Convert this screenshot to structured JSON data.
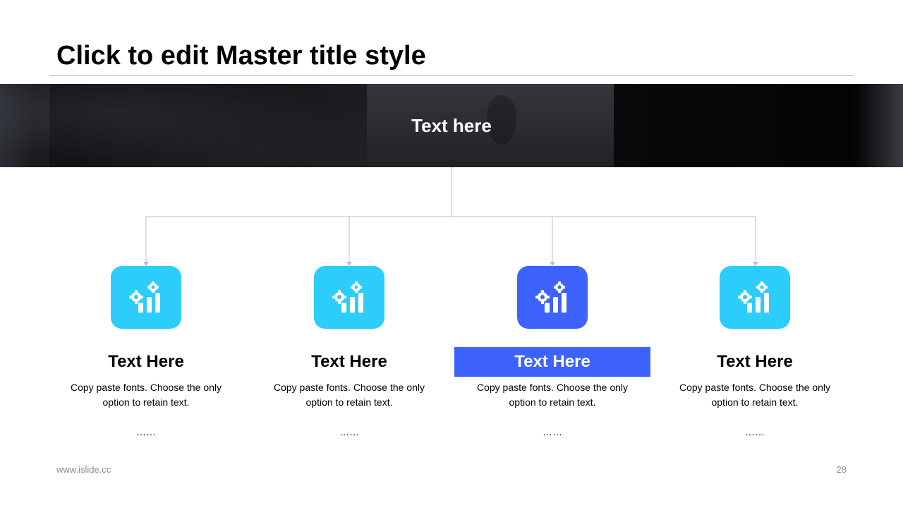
{
  "slide": {
    "title": "Click to edit Master title style"
  },
  "banner": {
    "text": "Text here"
  },
  "items": [
    {
      "title": "Text Here",
      "desc_line1": "Copy paste fonts. Choose the only",
      "desc_line2": "option to retain text.",
      "more": "……",
      "icon": "gear-bar-chart-icon"
    },
    {
      "title": "Text Here",
      "desc_line1": "Copy paste fonts. Choose the only",
      "desc_line2": "option to retain text.",
      "more": "……",
      "icon": "gear-bar-chart-icon"
    },
    {
      "title": "Text Here",
      "desc_line1": "Copy paste fonts. Choose the only",
      "desc_line2": "option to retain text.",
      "more": "……",
      "icon": "gear-bar-chart-icon",
      "highlighted": true
    },
    {
      "title": "Text Here",
      "desc_line1": "Copy paste fonts. Choose the only",
      "desc_line2": "option to retain text.",
      "more": "……",
      "icon": "gear-bar-chart-icon"
    }
  ],
  "colors": {
    "icon_default": "#2ccdfb",
    "icon_active": "#3d63fc",
    "connector": "#bfbfbf"
  },
  "footer": {
    "url": "www.islide.cc",
    "page": "28"
  }
}
